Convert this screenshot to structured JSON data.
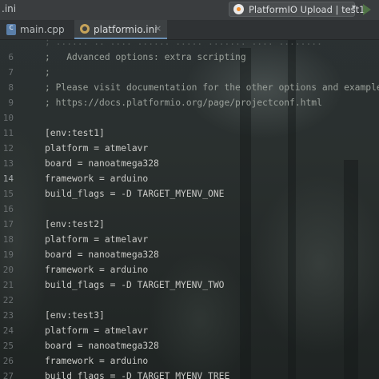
{
  "topbar": {
    "project_label": ".ini",
    "run_config_label": "PlatformIO Upload | test1"
  },
  "tabs": [
    {
      "label": "main.cpp"
    },
    {
      "label": "platformio.ini"
    }
  ],
  "editor": {
    "lines": [
      {
        "num": "",
        "text": "; ...... .. .... ...... ..... ....... .... ........"
      },
      {
        "num": "6",
        "text": ";   Advanced options: extra scripting"
      },
      {
        "num": "7",
        "text": ";"
      },
      {
        "num": "8",
        "text": "; Please visit documentation for the other options and examples"
      },
      {
        "num": "9",
        "text": "; https://docs.platformio.org/page/projectconf.html"
      },
      {
        "num": "10",
        "text": ""
      },
      {
        "num": "11",
        "text": "[env:test1]"
      },
      {
        "num": "12",
        "text": "platform = atmelavr"
      },
      {
        "num": "13",
        "text": "board = nanoatmega328"
      },
      {
        "num": "14",
        "text": "framework = arduino"
      },
      {
        "num": "15",
        "text": "build_flags = -D TARGET_MYENV_ONE"
      },
      {
        "num": "16",
        "text": ""
      },
      {
        "num": "17",
        "text": "[env:test2]"
      },
      {
        "num": "18",
        "text": "platform = atmelavr"
      },
      {
        "num": "19",
        "text": "board = nanoatmega328"
      },
      {
        "num": "20",
        "text": "framework = arduino"
      },
      {
        "num": "21",
        "text": "build_flags = -D TARGET_MYENV_TWO"
      },
      {
        "num": "22",
        "text": ""
      },
      {
        "num": "23",
        "text": "[env:test3]"
      },
      {
        "num": "24",
        "text": "platform = atmelavr"
      },
      {
        "num": "25",
        "text": "board = nanoatmega328"
      },
      {
        "num": "26",
        "text": "framework = arduino"
      },
      {
        "num": "27",
        "text": "build_flags = -D TARGET_MYENV_TREE"
      }
    ],
    "current_line": "14"
  }
}
